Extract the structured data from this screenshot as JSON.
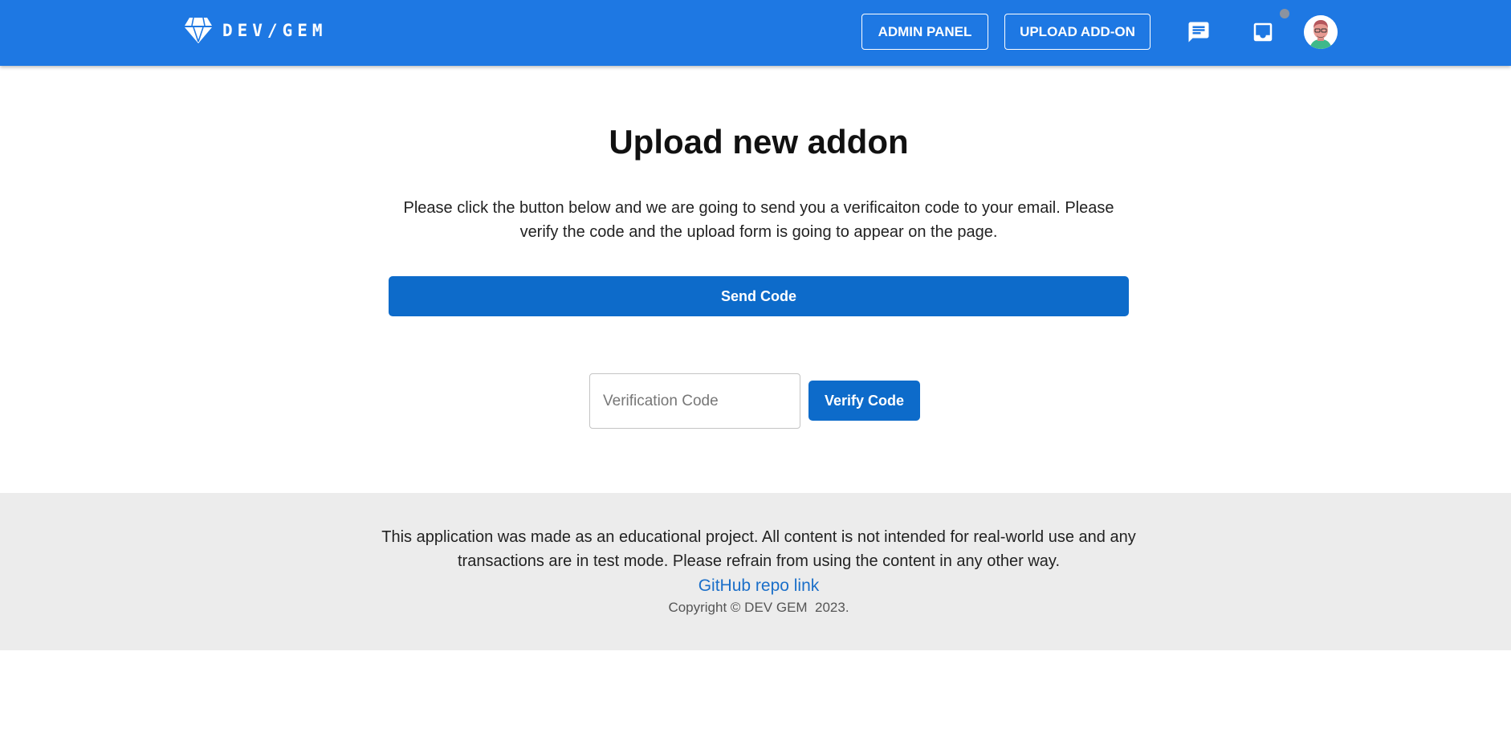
{
  "header": {
    "brand_text": "DEV/GEM",
    "admin_panel_label": "ADMIN PANEL",
    "upload_addon_label": "UPLOAD ADD-ON",
    "icons": [
      "diamond-logo-icon",
      "chat-icon",
      "inbox-icon",
      "notification-dot",
      "user-avatar"
    ],
    "accent_color": "#1e78e3"
  },
  "main": {
    "title": "Upload new addon",
    "description": "Please click the button below and we are going to send you a verificaiton code to your email. Please verify the code and the upload form is going to appear on the page.",
    "send_code_label": "Send Code",
    "verification_input": {
      "value": "",
      "placeholder": "Verification Code"
    },
    "verify_code_label": "Verify Code",
    "button_color": "#0d6bca"
  },
  "footer": {
    "notice": "This application was made as an educational project. All content is not intended for real-world use and any transactions are in test mode. Please refrain from using the content in any other way.",
    "repo_link_label": "GitHub repo link",
    "copyright": "Copyright © DEV GEM  2023.",
    "background_color": "#ececec"
  }
}
